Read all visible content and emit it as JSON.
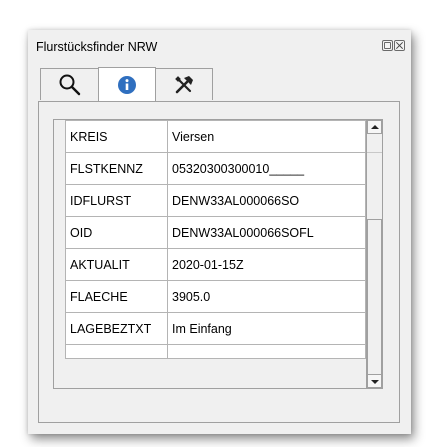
{
  "window": {
    "title": "Flurstücksfinder NRW"
  },
  "tabs": [
    {
      "icon": "search-icon",
      "active": false
    },
    {
      "icon": "info-icon",
      "active": true
    },
    {
      "icon": "tools-icon",
      "active": false
    }
  ],
  "attributes": [
    {
      "key": "KREIS",
      "value": "Viersen"
    },
    {
      "key": "FLSTKENNZ",
      "value": "05320300300010_____"
    },
    {
      "key": "IDFLURST",
      "value": "DENW33AL000066SO"
    },
    {
      "key": "OID",
      "value": "DENW33AL000066SOFL"
    },
    {
      "key": "AKTUALIT",
      "value": "2020-01-15Z"
    },
    {
      "key": "FLAECHE",
      "value": "3905.0"
    },
    {
      "key": "LAGEBEZTXT",
      "value": "Im Einfang"
    }
  ],
  "colors": {
    "panel_bg": "#f0f0f0",
    "border": "#a0a0a0",
    "info_icon": "#2f6fbf"
  }
}
